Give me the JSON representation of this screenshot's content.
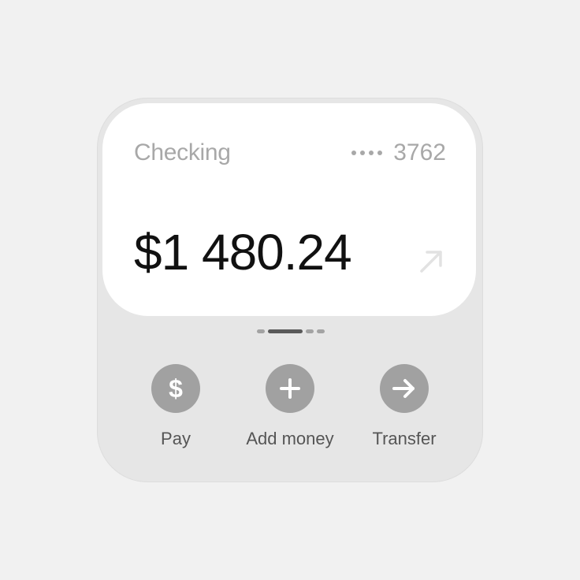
{
  "widget": {
    "account_name": "Checking",
    "account_mask_prefix": "••••",
    "account_last4": "3762",
    "balance": "$1 480.24",
    "open_icon": "arrow-up-right-icon",
    "pager": {
      "page_count": 4,
      "active_page": 2
    },
    "actions": [
      {
        "label": "Pay",
        "icon": "dollar-icon"
      },
      {
        "label": "Add money",
        "icon": "plus-icon"
      },
      {
        "label": "Transfer",
        "icon": "arrow-right-icon"
      }
    ]
  },
  "colors": {
    "background": "#f1f1f1",
    "widget_bg": "#e6e6e6",
    "card_bg": "#ffffff",
    "muted_text": "#a8a8a8",
    "balance_text": "#111111",
    "action_circle": "#a1a1a1",
    "action_label": "#555555"
  }
}
